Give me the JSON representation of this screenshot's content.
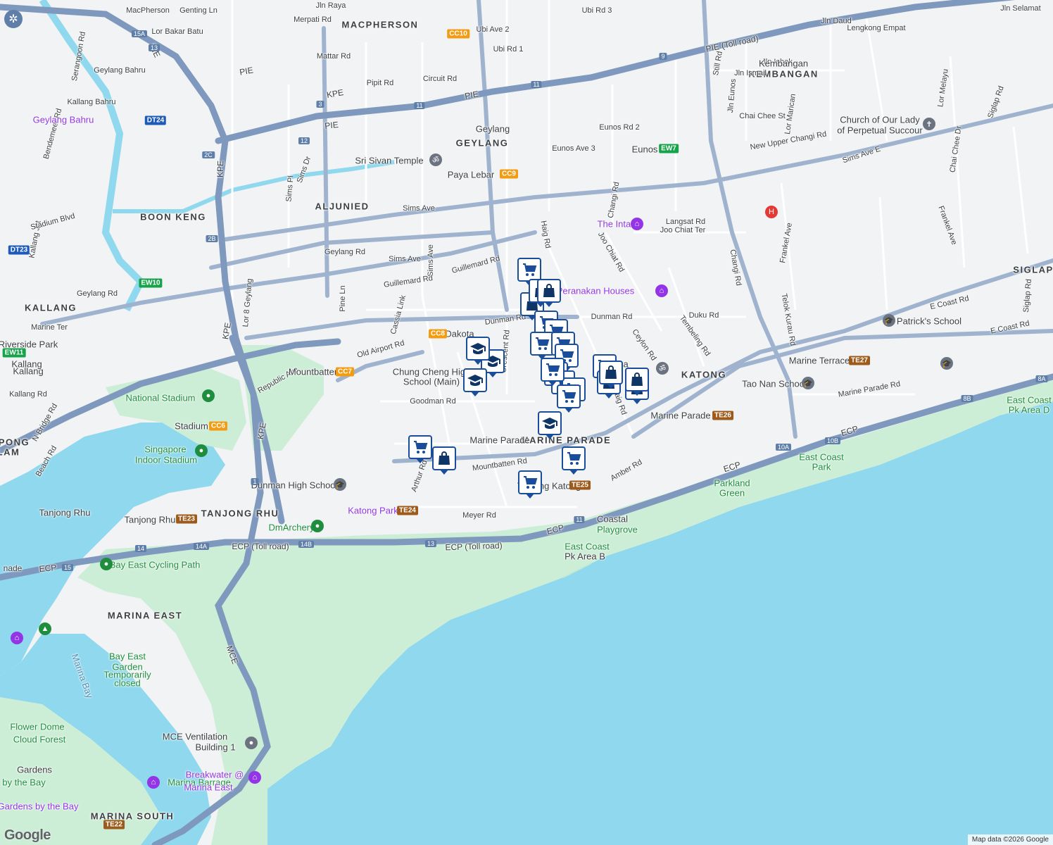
{
  "map": {
    "area_labels": [
      {
        "text": "MACPHERSON"
      },
      {
        "text": "KEMBANGAN"
      },
      {
        "text": "GEYLANG"
      },
      {
        "text": "ALJUNIED"
      },
      {
        "text": "BOON KENG"
      },
      {
        "text": "KALLANG"
      },
      {
        "text": "SIGLAP"
      },
      {
        "text": "KATONG"
      },
      {
        "text": "MARINE PARADE"
      },
      {
        "text": "TANJONG RHU"
      },
      {
        "text": "MARINA EAST"
      },
      {
        "text": "MARINA SOUTH"
      },
      {
        "text": "PONG"
      },
      {
        "text": "LAM"
      }
    ],
    "road_labels": [
      {
        "text": "MacPherson"
      },
      {
        "text": "Genting Ln"
      },
      {
        "text": "Lor Bakar Batu"
      },
      {
        "text": "Jln Raya"
      },
      {
        "text": "Merpati Rd"
      },
      {
        "text": "Mattar Rd"
      },
      {
        "text": "Pipit Rd"
      },
      {
        "text": "Circuit Rd"
      },
      {
        "text": "Ubi Ave 2"
      },
      {
        "text": "Ubi Rd 1"
      },
      {
        "text": "Ubi Rd 3"
      },
      {
        "text": "Serangoon Rd"
      },
      {
        "text": "Bendemeer Rd"
      },
      {
        "text": "Geylang Bahru"
      },
      {
        "text": "Kallang Bahru"
      },
      {
        "text": "Kallang Jct"
      },
      {
        "text": "Sims Dr"
      },
      {
        "text": "Sims Pl"
      },
      {
        "text": "Sims Ave"
      },
      {
        "text": "Sims Ave"
      },
      {
        "text": "Sims Ave"
      },
      {
        "text": "Geylang Rd"
      },
      {
        "text": "Geylang Rd"
      },
      {
        "text": "Guillemard Rd"
      },
      {
        "text": "Guillemard Rd"
      },
      {
        "text": "Lor 8 Geylang"
      },
      {
        "text": "Pine Ln"
      },
      {
        "text": "Cassia Link"
      },
      {
        "text": "Old Airport Rd"
      },
      {
        "text": "Dunman Rd"
      },
      {
        "text": "Dunman Rd"
      },
      {
        "text": "Crescent Rd"
      },
      {
        "text": "Goodman Rd"
      },
      {
        "text": "Mountbatten Rd"
      },
      {
        "text": "Arthur Rd"
      },
      {
        "text": "Meyer Rd"
      },
      {
        "text": "Amber Rd"
      },
      {
        "text": "Haig Rd"
      },
      {
        "text": "Haig Rd"
      },
      {
        "text": "Joo Chiat Rd"
      },
      {
        "text": "Ceylon Rd"
      },
      {
        "text": "Tembeling Rd"
      },
      {
        "text": "Duku Rd"
      },
      {
        "text": "Langsat Rd"
      },
      {
        "text": "Joo Chiat Ter"
      },
      {
        "text": "Eunos Ave 3"
      },
      {
        "text": "Eunos Rd 2"
      },
      {
        "text": "Changi Rd"
      },
      {
        "text": "Changi Rd"
      },
      {
        "text": "Still Rd"
      },
      {
        "text": "Jln Eunos"
      },
      {
        "text": "Jln Ismail"
      },
      {
        "text": "Jln Ishak"
      },
      {
        "text": "Jln Daud"
      },
      {
        "text": "Lengkong Empat"
      },
      {
        "text": "Jln Selamat"
      },
      {
        "text": "Chai Chee St"
      },
      {
        "text": "Lor Marican"
      },
      {
        "text": "Lor Melayu"
      },
      {
        "text": "Chai Chee Dr"
      },
      {
        "text": "Siglap Rd"
      },
      {
        "text": "Siglap Rd"
      },
      {
        "text": "New Upper Changi Rd"
      },
      {
        "text": "Sims Ave E"
      },
      {
        "text": "Frankel Ave"
      },
      {
        "text": "Frankel Ave"
      },
      {
        "text": "Telok Kurau Rd"
      },
      {
        "text": "E Coast Rd"
      },
      {
        "text": "E Coast Rd"
      },
      {
        "text": "Marine Parade Rd"
      },
      {
        "text": "Marine Ter"
      },
      {
        "text": "Kallang Rd"
      },
      {
        "text": "N Bridge Rd"
      },
      {
        "text": "Beach Rd"
      },
      {
        "text": "Republic Ave"
      },
      {
        "text": "Stadium Blvd"
      },
      {
        "text": "Kallang Bahru"
      }
    ],
    "highway_labels": [
      {
        "text": "PIE"
      },
      {
        "text": "PIE"
      },
      {
        "text": "PIE"
      },
      {
        "text": "PIE"
      },
      {
        "text": "PIE (Toll road)"
      },
      {
        "text": "KPE"
      },
      {
        "text": "KPE"
      },
      {
        "text": "KPE"
      },
      {
        "text": "KPE"
      },
      {
        "text": "MCE"
      },
      {
        "text": "ECP (Toll road)"
      },
      {
        "text": "ECP (Toll road)"
      },
      {
        "text": "ECP"
      },
      {
        "text": "ECP"
      },
      {
        "text": "ECP"
      },
      {
        "text": "ECP"
      },
      {
        "text": "nade"
      }
    ],
    "road_numbers": [
      {
        "text": "15A"
      },
      {
        "text": "13"
      },
      {
        "text": "3"
      },
      {
        "text": "12"
      },
      {
        "text": "11"
      },
      {
        "text": "11"
      },
      {
        "text": "9"
      },
      {
        "text": "2C"
      },
      {
        "text": "2B"
      },
      {
        "text": "1"
      },
      {
        "text": "14"
      },
      {
        "text": "14A"
      },
      {
        "text": "14B"
      },
      {
        "text": "13"
      },
      {
        "text": "11"
      },
      {
        "text": "15"
      },
      {
        "text": "10A"
      },
      {
        "text": "10B"
      },
      {
        "text": "8B"
      },
      {
        "text": "8A"
      }
    ],
    "poi_labels": [
      {
        "text": "Sri Sivan Temple"
      },
      {
        "text": "Paya Lebar"
      },
      {
        "text": "Eunos"
      },
      {
        "text": "The Intan"
      },
      {
        "text": "Peranakan Houses"
      },
      {
        "text": "Church of Our Lady"
      },
      {
        "text": "of Perpetual Succour"
      },
      {
        "text": "St Patrick's School"
      },
      {
        "text": "Marine Terrace"
      },
      {
        "text": "Tao Nan School"
      },
      {
        "text": "Marine Parade"
      },
      {
        "text": "Dakota"
      },
      {
        "text": "Mountbatten"
      },
      {
        "text": "Chung Cheng High"
      },
      {
        "text": "School (Main)"
      },
      {
        "text": "Kallang"
      },
      {
        "text": "Kallang"
      },
      {
        "text": "Riverside Park"
      },
      {
        "text": "National Stadium"
      },
      {
        "text": "Stadium"
      },
      {
        "text": "Singapore"
      },
      {
        "text": "Indoor Stadium"
      },
      {
        "text": "Dunman High School"
      },
      {
        "text": "Tanjong Rhu"
      },
      {
        "text": "Tanjong Rhu"
      },
      {
        "text": "Katong Park"
      },
      {
        "text": "DmArchery"
      },
      {
        "text": "Bay East Cycling Path"
      },
      {
        "text": "Tanjong Katong"
      },
      {
        "text": "Coastal"
      },
      {
        "text": "Playgrove"
      },
      {
        "text": "East Coast"
      },
      {
        "text": "Pk Area B"
      },
      {
        "text": "Parkland"
      },
      {
        "text": "Green"
      },
      {
        "text": "East Coast"
      },
      {
        "text": "Park"
      },
      {
        "text": "East Coast"
      },
      {
        "text": "Pk Area D"
      },
      {
        "text": "Bay East"
      },
      {
        "text": "Garden"
      },
      {
        "text": "Temporarily"
      },
      {
        "text": "closed"
      },
      {
        "text": "Marina Bay"
      },
      {
        "text": "Flower Dome"
      },
      {
        "text": "Cloud Forest"
      },
      {
        "text": "MCE Ventilation"
      },
      {
        "text": "Building 1"
      },
      {
        "text": "Gardens"
      },
      {
        "text": "by the Bay"
      },
      {
        "text": "Marina Barrage"
      },
      {
        "text": "Breakwater @"
      },
      {
        "text": "Marina East"
      },
      {
        "text": "Gardens by the Bay"
      },
      {
        "text": "Geylang Bahru"
      },
      {
        "text": "Kembangan"
      },
      {
        "text": "Marine Parade"
      },
      {
        "text": "enpaga"
      },
      {
        "text": "Geylang"
      }
    ],
    "stations": [
      {
        "text": "CC10",
        "color": "#f39c12"
      },
      {
        "text": "CC9",
        "color": "#f39c12"
      },
      {
        "text": "EW7",
        "color": "#16a34a"
      },
      {
        "text": "DT24",
        "color": "#1e5bb8"
      },
      {
        "text": "DT23",
        "color": "#1e5bb8"
      },
      {
        "text": "EW10",
        "color": "#16a34a"
      },
      {
        "text": "EW11",
        "color": "#16a34a"
      },
      {
        "text": "CC8",
        "color": "#f39c12"
      },
      {
        "text": "CC7",
        "color": "#f39c12"
      },
      {
        "text": "CC6",
        "color": "#f39c12"
      },
      {
        "text": "TE27",
        "color": "#9c5b1b"
      },
      {
        "text": "TE26",
        "color": "#9c5b1b"
      },
      {
        "text": "TE25",
        "color": "#9c5b1b"
      },
      {
        "text": "TE24",
        "color": "#9c5b1b"
      },
      {
        "text": "TE23",
        "color": "#9c5b1b"
      },
      {
        "text": "TE22",
        "color": "#9c5b1b"
      }
    ],
    "markers": [
      {
        "icon": "cart"
      },
      {
        "icon": "bag"
      },
      {
        "icon": "bag"
      },
      {
        "icon": "cart"
      },
      {
        "icon": "cart"
      },
      {
        "icon": "cart"
      },
      {
        "icon": "cart"
      },
      {
        "icon": "cart"
      },
      {
        "icon": "cart"
      },
      {
        "icon": "cart"
      },
      {
        "icon": "cart"
      },
      {
        "icon": "cart"
      },
      {
        "icon": "cart"
      },
      {
        "icon": "school"
      },
      {
        "icon": "school"
      },
      {
        "icon": "school"
      },
      {
        "icon": "cart"
      },
      {
        "icon": "bag"
      },
      {
        "icon": "bag"
      },
      {
        "icon": "bag"
      },
      {
        "icon": "school"
      },
      {
        "icon": "cart"
      },
      {
        "icon": "bag"
      },
      {
        "icon": "cart"
      },
      {
        "icon": "cart"
      },
      {
        "icon": "bag"
      },
      {
        "icon": "bag"
      }
    ],
    "colors": {
      "water": "#8fd8ee",
      "land": "#f1f3f4",
      "park": "#cdeed6",
      "highway": "#8aa3c4",
      "road": "#ffffff",
      "marker": "#1a4d9a"
    }
  },
  "attribution": "Map data ©2026 Google",
  "logo": "Google"
}
